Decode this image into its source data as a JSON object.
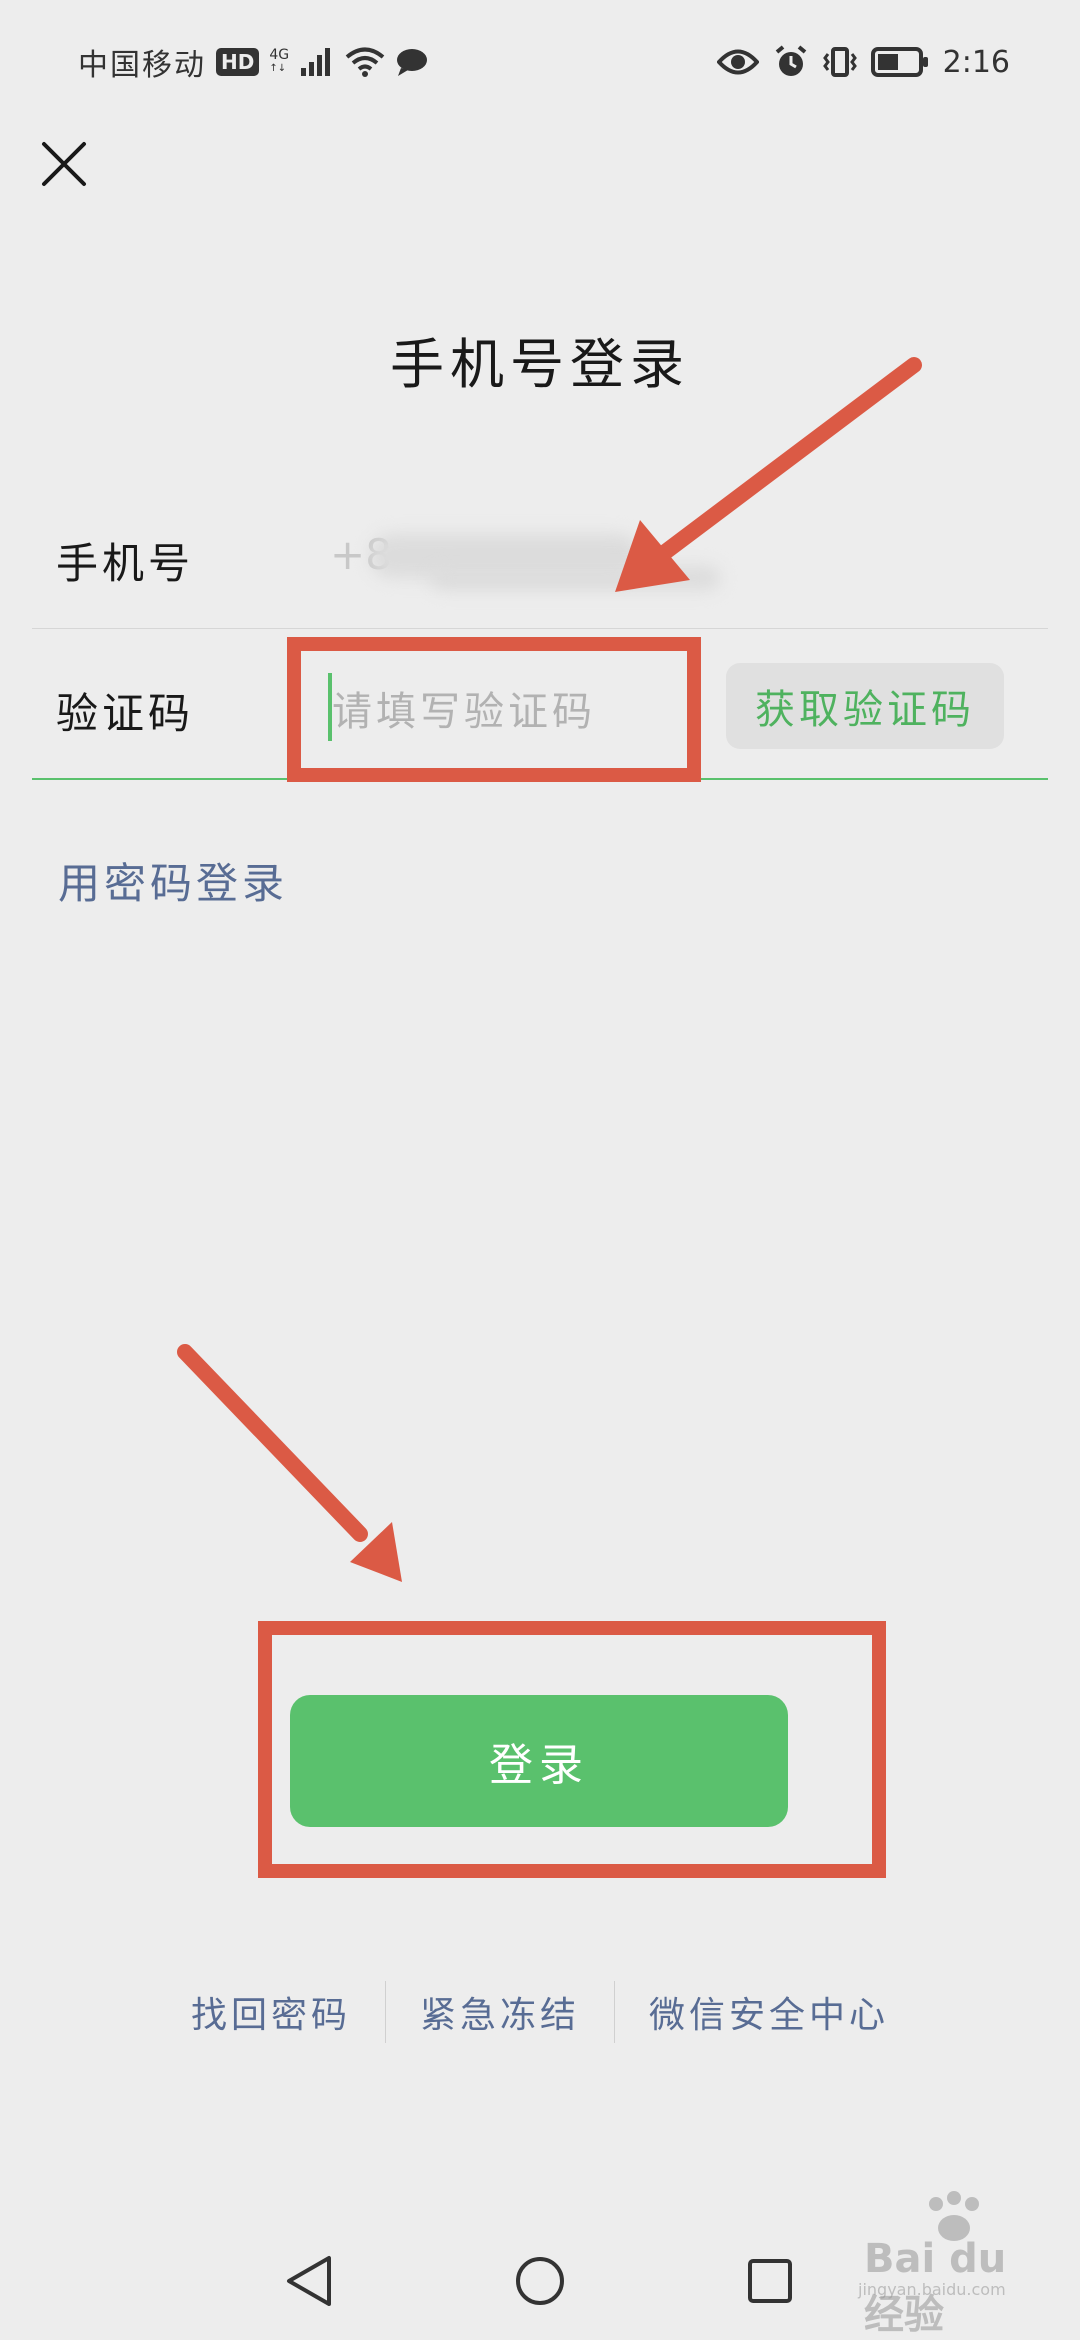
{
  "status_bar": {
    "carrier": "中国移动",
    "hd_badge": "HD",
    "network": "4G",
    "time": "2:16"
  },
  "header": {
    "close_icon": "close-icon",
    "title": "手机号登录"
  },
  "form": {
    "phone_label": "手机号",
    "phone_value_prefix": "+8",
    "code_label": "验证码",
    "code_placeholder": "请填写验证码",
    "code_value": "",
    "get_code_button": "获取验证码"
  },
  "password_login_link": "用密码登录",
  "login_button": "登录",
  "footer_links": [
    "找回密码",
    "紧急冻结",
    "微信安全中心"
  ],
  "nav_bar": {
    "back_icon": "back-triangle-icon",
    "home_icon": "home-circle-icon",
    "recents_icon": "recents-square-icon"
  },
  "watermark": {
    "brand": "Bai du 经验",
    "url": "jingyan.baidu.com"
  },
  "colors": {
    "background": "#ededed",
    "accent_green": "#5ac16d",
    "link_blue": "#586c94",
    "annotation_red": "#db5a45"
  }
}
